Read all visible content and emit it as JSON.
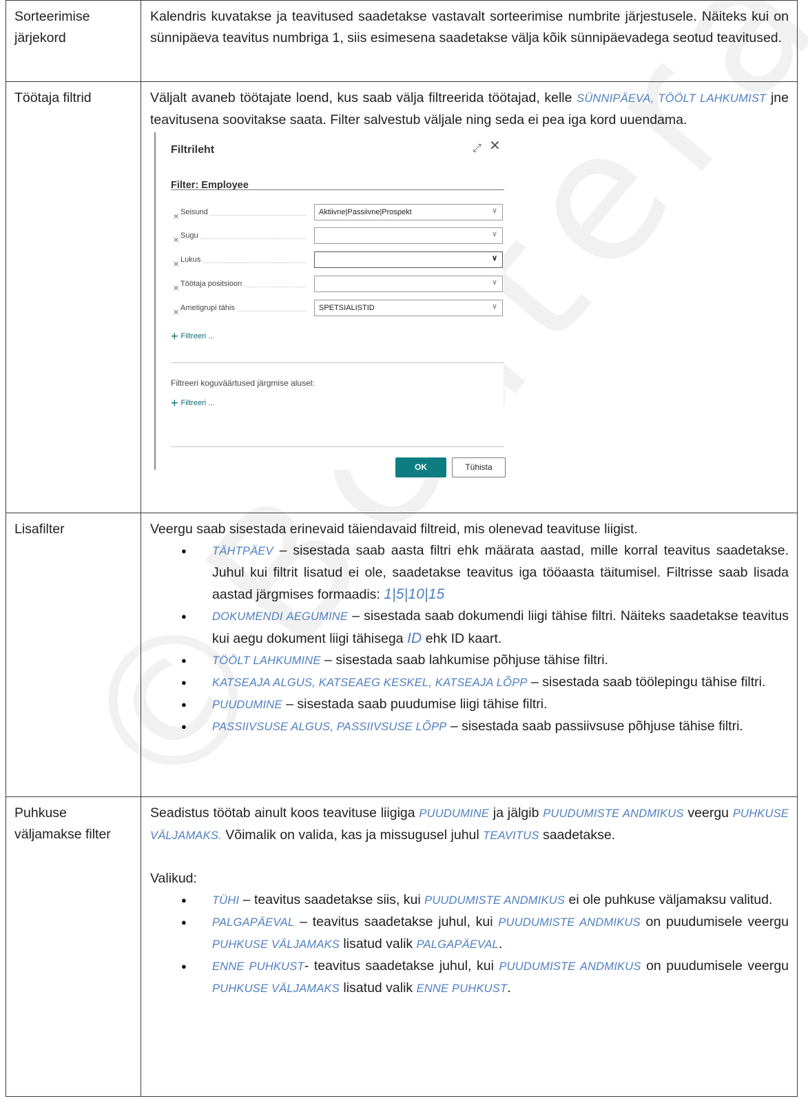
{
  "watermark": "©Bcutera AS",
  "rows": {
    "sorting": {
      "label": "Sorteerimise järjekord",
      "text": "Kalendris kuvatakse ja teavitused saadetakse vastavalt sorteerimise numbrite järjestusele. Näiteks kui on sünnipäeva teavitus numbriga 1, siis esimesena saadetakse välja kõik sünnipäevadega seotud teavitused."
    },
    "employee_filters": {
      "label": "Töötaja filtrid",
      "text_before": "Väljalt avaneb töötajate loend, kus saab välja filtreerida töötajad, kelle ",
      "highlight": "SÜNNIPÄEVA, TÖÖLT LAHKUMIST",
      "text_after": " jne teavitusena soovitakse saata.  Filter salvestub väljale ning seda ei pea iga kord uuendama."
    },
    "extra_filter": {
      "label": "Lisafilter",
      "intro": "Veergu saab sisestada erinevaid täiendavaid filtreid, mis olenevad teavituse liigist.",
      "items": [
        {
          "term": "TÄHTPÄEV",
          "text": " – sisestada saab aasta filtri ehk määrata aastad, mille korral teavitus saadetakse. Juhul kui filtrit lisatud ei ole, saadetakse teavitus iga tööaasta täitumisel.  Filtrisse saab lisada aastad järgmises formaadis: ",
          "example": "1|5|10|15"
        },
        {
          "term": "DOKUMENDI AEGUMINE",
          "text": " – sisestada saab dokumendi liigi tähise filtri. Näiteks saadetakse teavitus kui aegu dokument liigi tähisega ",
          "example": "ID",
          "text2": "  ehk ID kaart."
        },
        {
          "term": "TÖÖLT LAHKUMINE",
          "text": " – sisestada saab lahkumise põhjuse tähise filtri."
        },
        {
          "term": "KATSEAJA ALGUS, KATSEAEG KESKEL, KATSEAJA LÕPP",
          "text": " – sisestada saab töölepingu tähise filtri."
        },
        {
          "term": "PUUDUMINE",
          "text": " – sisestada saab puudumise liigi tähise filtri."
        },
        {
          "term": "PASSIIVSUSE ALGUS, PASSIIVSUSE LÕPP",
          "text": " – sisestada saab passiivsuse põhjuse tähise filtri."
        }
      ]
    },
    "vacation_pay": {
      "label": "Puhkuse väljamakse filter",
      "p1": [
        "Seadistus töötab ainult koos teavituse liigiga ",
        "PUUDUMINE",
        " ja jälgib ",
        "PUUDUMISTE ANDMIKUS",
        " veergu ",
        "PUHKUSE VÄLJAMAKS.",
        " Võimalik on valida, kas ja missugusel juhul ",
        "TEAVITUS",
        " saadetakse."
      ],
      "options_label": "Valikud:",
      "items": [
        [
          "TÜHI",
          " – teavitus saadetakse siis, kui ",
          "PUUDUMISTE ANDMIKUS",
          " ei ole puhkuse väljamaksu valitud."
        ],
        [
          "PALGAPÄEVAL",
          " – teavitus saadetakse juhul, kui ",
          "PUUDUMISTE ANDMIKUS",
          " on puudumisele veergu ",
          "PUHKUSE VÄLJAMAKS",
          " lisatud valik ",
          "PALGAPÄEVAL",
          "."
        ],
        [
          "ENNE PUHKUST",
          "- teavitus saadetakse juhul, kui ",
          "PUUDUMISTE ANDMIKUS",
          " on puudumisele veergu ",
          "PUHKUSE VÄLJAMAKS",
          " lisatud valik ",
          "ENNE PUHKUST",
          "."
        ]
      ]
    }
  },
  "dialog": {
    "title": "Filtrileht",
    "filter_header": "Filter: Employee",
    "fields": [
      {
        "name": "Seisund",
        "value": "Aktiivne|Passiivne|Prospekt"
      },
      {
        "name": "Sugu",
        "value": ""
      },
      {
        "name": "Lukus",
        "value": ""
      },
      {
        "name": "Töötaja positsioon",
        "value": ""
      },
      {
        "name": "Ametigrupi tähis",
        "value": "SPETSIALISTID"
      }
    ],
    "add_filter": "Filtreeri ...",
    "totals_label": "Filtreeri koguväärtused järgmise alusel:",
    "ok": "OK",
    "cancel": "Tühista"
  }
}
